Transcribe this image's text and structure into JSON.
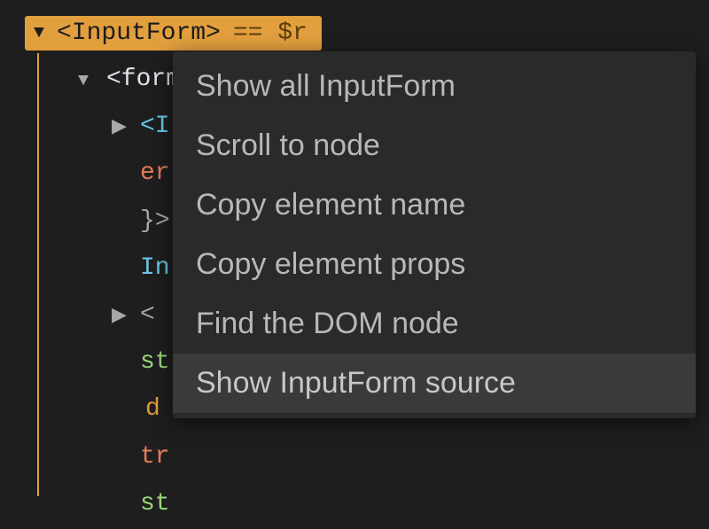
{
  "selected": {
    "tag": "<InputForm>",
    "suffix": "== $r"
  },
  "tree": {
    "form": {
      "open": "<form"
    },
    "input": {
      "open": "<I"
    },
    "err": "er",
    "close_brace": "}>",
    "inp_text": "In",
    "lt": "<",
    "st1": "st",
    "d": "d",
    "tr": "tr",
    "st2": "st"
  },
  "menu": {
    "items": [
      "Show all InputForm",
      "Scroll to node",
      "Copy element name",
      "Copy element props",
      "Find the DOM node",
      "Show InputForm source"
    ],
    "hovered_index": 5
  }
}
